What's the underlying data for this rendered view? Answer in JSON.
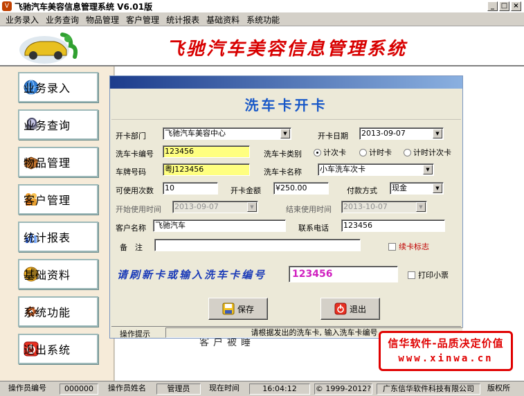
{
  "window": {
    "title": "飞驰汽车美容信息管理系统   V6.01版"
  },
  "menu": [
    "业务录入",
    "业务查询",
    "物品管理",
    "客户管理",
    "统计报表",
    "基础资料",
    "系统功能"
  ],
  "header": {
    "banner": "飞驰汽车美容信息管理系统"
  },
  "sidebar": [
    {
      "label": "业务录入",
      "icon": "globe-icon"
    },
    {
      "label": "业务查询",
      "icon": "magnifier-icon"
    },
    {
      "label": "物品管理",
      "icon": "box-icon"
    },
    {
      "label": "客户管理",
      "icon": "people-icon"
    },
    {
      "label": "统计报表",
      "icon": "chart-icon"
    },
    {
      "label": "基础资料",
      "icon": "database-icon"
    },
    {
      "label": "系统功能",
      "icon": "gear-icon"
    },
    {
      "label": "退出系统",
      "icon": "power-icon"
    }
  ],
  "background_text": "客户被睡",
  "dialog": {
    "title": "洗车卡开卡",
    "dept_label": "开卡部门",
    "dept_value": "飞驰汽车美容中心",
    "date_label": "开卡日期",
    "date_value": "2013-09-07",
    "card_no_label": "洗车卡编号",
    "card_no_value": "123456",
    "card_type_label": "洗车卡类别",
    "card_types": [
      "计次卡",
      "计时卡",
      "计时计次卡"
    ],
    "card_type_selected": "计次卡",
    "plate_label": "车牌号码",
    "plate_value": "粤J123456",
    "card_name_label": "洗车卡名称",
    "card_name_value": "小车洗车次卡",
    "times_label": "可使用次数",
    "times_value": "10",
    "amount_label": "开卡金额",
    "amount_value": "¥250.00",
    "pay_label": "付款方式",
    "pay_value": "现金",
    "start_label": "开始使用时间",
    "start_value": "2013-09-07",
    "end_label": "结束使用时间",
    "end_value": "2013-10-07",
    "customer_label": "客户名称",
    "customer_value": "飞驰汽车",
    "phone_label": "联系电话",
    "phone_value": "123456",
    "note_label": "备　注",
    "note_value": "",
    "renew_label": "续卡标志",
    "prompt": "请刷新卡或输入洗车卡编号",
    "swipe_value": "123456",
    "print_label": "打印小票",
    "save_label": "保存",
    "exit_label": "退出",
    "tip_label": "操作提示",
    "tip_value": "请根据发出的洗车卡, 输入洗车卡编号"
  },
  "watermark": {
    "line1": "信华软件-品质决定价值",
    "line2": "www.xinwa.cn"
  },
  "statusbar": {
    "op_id_label": "操作员编号",
    "op_id_value": "000000",
    "op_name_label": "操作员姓名",
    "op_name_value": "管理员",
    "time_label": "现在时间",
    "time_value": "16:04:12",
    "copyright": "© 1999-2012?",
    "company": "广东信华软件科技有限公司",
    "rights": "版权所"
  },
  "colors": {
    "banner": "#d80000",
    "prompt": "#1c3cb8",
    "title": "#1858c8",
    "yellow_field": "#ffff80",
    "watermark": "#e00000"
  }
}
